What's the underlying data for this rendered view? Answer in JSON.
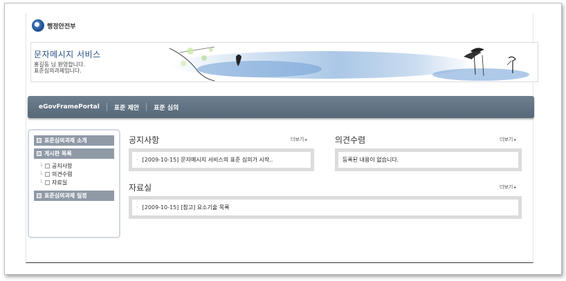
{
  "logo": {
    "text": "행정안전부",
    "icon": "government-emblem-icon"
  },
  "banner": {
    "title": "문자메시지 서비스",
    "welcome_line1": "홍길동 님 환영합니다.",
    "welcome_line2": "표준심의과제입니다."
  },
  "nav": {
    "items": [
      {
        "label": "eGovFramePortal"
      },
      {
        "label": "표준 제안"
      },
      {
        "label": "표준 심의"
      }
    ]
  },
  "sidebar": {
    "sections": [
      {
        "label": "표준심의과제 소개"
      },
      {
        "label": "게시판 목록"
      },
      {
        "label": "표준심의과제 일정"
      }
    ],
    "board_items": [
      {
        "label": "공지사항"
      },
      {
        "label": "의견수렴"
      },
      {
        "label": "자료실"
      }
    ]
  },
  "notice": {
    "title": "공지사항",
    "more": "더보기",
    "date": "[2009-10-15]",
    "text": "문자메시지 서비스의 표준 심의가 시작.."
  },
  "opinion": {
    "title": "의견수렴",
    "more": "더보기",
    "empty": "등록된 내용이 없습니다."
  },
  "archive": {
    "title": "자료실",
    "more": "더보기",
    "date": "[2009-10-15]",
    "text": "[참고] 요소기술 목록"
  }
}
